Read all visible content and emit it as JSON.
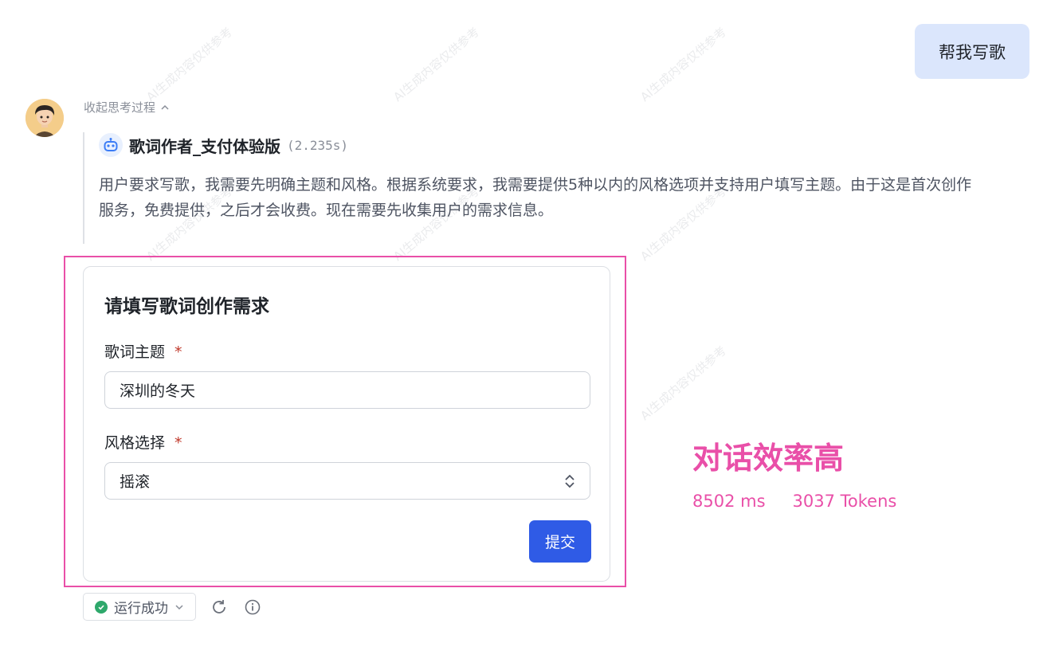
{
  "watermark_text": "AI生成内容仅供参考",
  "user_message": "帮我写歌",
  "thinking": {
    "toggle_label": "收起思考过程",
    "agent_name": "歌词作者_支付体验版",
    "agent_time": "(2.235s)",
    "text": "用户要求写歌，我需要先明确主题和风格。根据系统要求，我需要提供5种以内的风格选项并支持用户填写主题。由于这是首次创作服务，免费提供，之后才会收费。现在需要先收集用户的需求信息。"
  },
  "form": {
    "title": "请填写歌词创作需求",
    "topic_label": "歌词主题",
    "topic_value": "深圳的冬天",
    "style_label": "风格选择",
    "style_value": "摇滚",
    "required_mark": "*",
    "submit_label": "提交"
  },
  "annotation": {
    "title": "对话效率高",
    "latency": "8502 ms",
    "tokens": "3037 Tokens"
  },
  "status": {
    "label": "运行成功"
  },
  "colors": {
    "accent_pink": "#e94fa8",
    "primary_blue": "#2f5be6",
    "success_green": "#2ea86b",
    "user_bubble": "#dbe6fc"
  }
}
